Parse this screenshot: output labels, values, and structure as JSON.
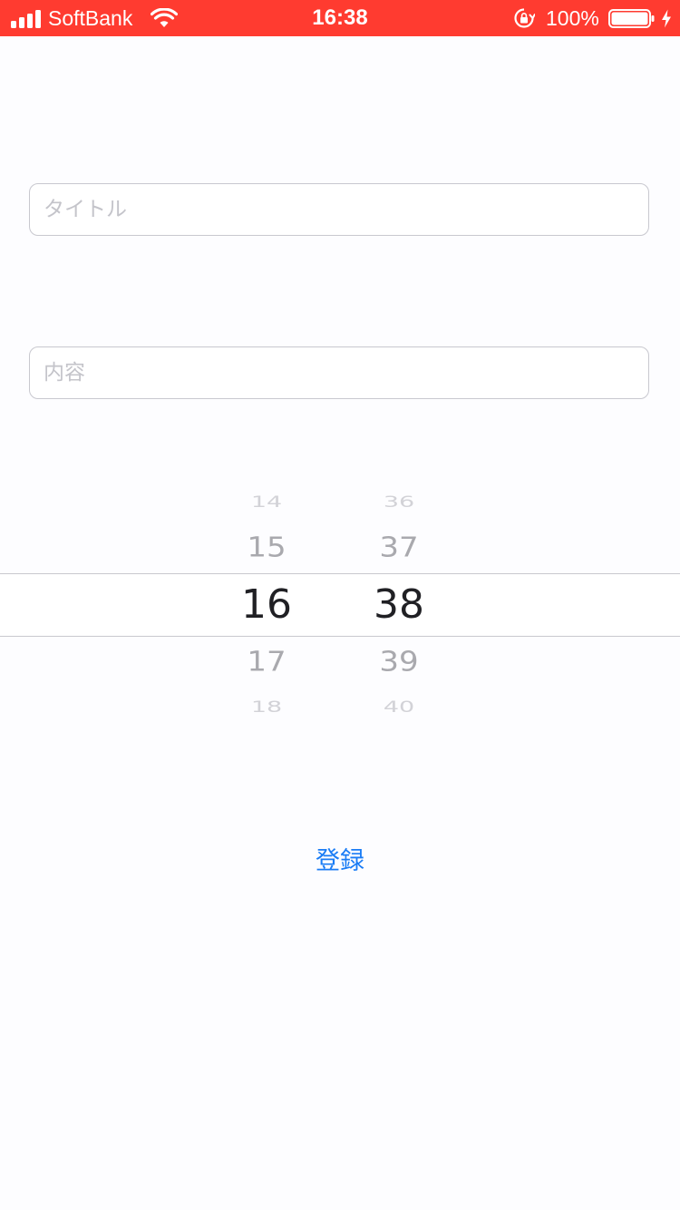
{
  "status_bar": {
    "carrier": "SoftBank",
    "time": "16:38",
    "battery_percent": "100%",
    "icons": [
      "signal-bars-icon",
      "wifi-icon",
      "rotation-lock-icon",
      "battery-icon",
      "charging-bolt-icon"
    ],
    "background_color": "#ff3b30"
  },
  "form": {
    "title_placeholder": "タイトル",
    "title_value": "",
    "content_placeholder": "内容",
    "content_value": ""
  },
  "time_picker": {
    "hours": [
      "14",
      "15",
      "16",
      "17",
      "18"
    ],
    "minutes": [
      "36",
      "37",
      "38",
      "39",
      "40"
    ],
    "selected_hour": "16",
    "selected_minute": "38"
  },
  "register_button_label": "登録",
  "colors": {
    "accent": "#1a7cf5",
    "background": "#fdfdff"
  }
}
